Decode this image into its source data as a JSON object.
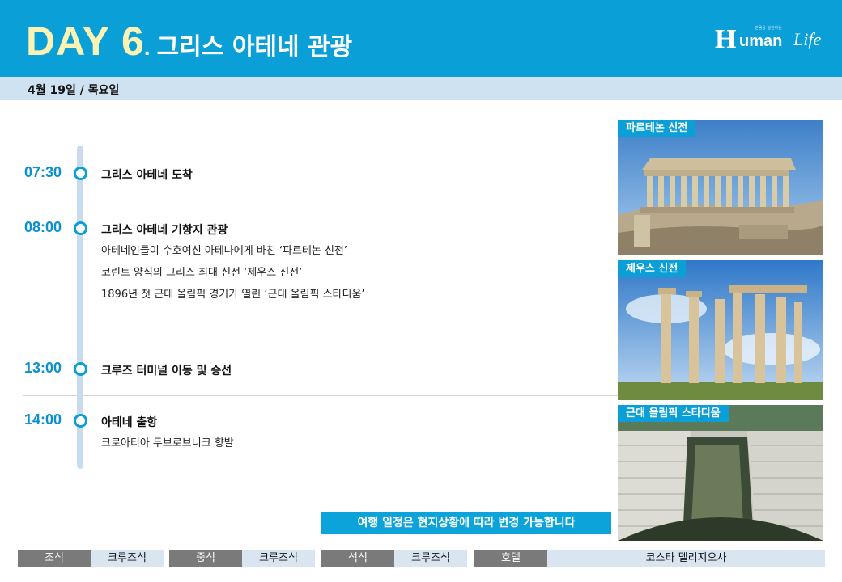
{
  "header": {
    "day_word": "DAY",
    "day_number": "6",
    "day_dot": ".",
    "day_subtitle": "그리스 아테네 관광",
    "logo": {
      "h": "H",
      "uman": "uman",
      "life": "Life",
      "tagline": "믿음을 실천하는"
    }
  },
  "date": "4월 19일 / 목요일",
  "schedule": [
    {
      "time": "07:30",
      "title": "그리스 아테네 도착",
      "details": []
    },
    {
      "time": "08:00",
      "title": "그리스 아테네 기항지 관광",
      "details": [
        "아테네인들이 수호여신 아테나에게 바친 ‘파르테논 신전’",
        "코린트 양식의 그리스 최대 신전 ‘제우스 신전’",
        "1896년 첫 근대 올림픽 경기가 열린 ‘근대 올림픽 스타디움’"
      ]
    },
    {
      "time": "13:00",
      "title": "크루즈 터미널 이동 및 승선",
      "details": []
    },
    {
      "time": "14:00",
      "title": "아테네 출항",
      "details": [
        "크로아티아 두브로브니크 향발"
      ]
    }
  ],
  "photos": [
    {
      "label": "파르테논 신전",
      "icon": "parthenon-photo"
    },
    {
      "label": "제우스 신전",
      "icon": "zeus-temple-photo"
    },
    {
      "label": "근대 올림픽 스타디움",
      "icon": "stadium-photo"
    }
  ],
  "notice": "여행 일정은 현지상황에 따라 변경 가능합니다",
  "meals": {
    "breakfast_label": "조식",
    "breakfast_value": "크루즈식",
    "lunch_label": "중식",
    "lunch_value": "크루즈식",
    "dinner_label": "석식",
    "dinner_value": "크루즈식",
    "hotel_label": "호텔",
    "hotel_value": "코스타 델리지오사"
  },
  "colors": {
    "accent": "#0a9fd6",
    "day_yellow": "#fbf3b4",
    "time_blue": "#0a8fcf",
    "datebar": "#cfe2f1",
    "meal_label_bg": "#7a7a7a",
    "meal_value_bg": "#d9e6f2"
  }
}
